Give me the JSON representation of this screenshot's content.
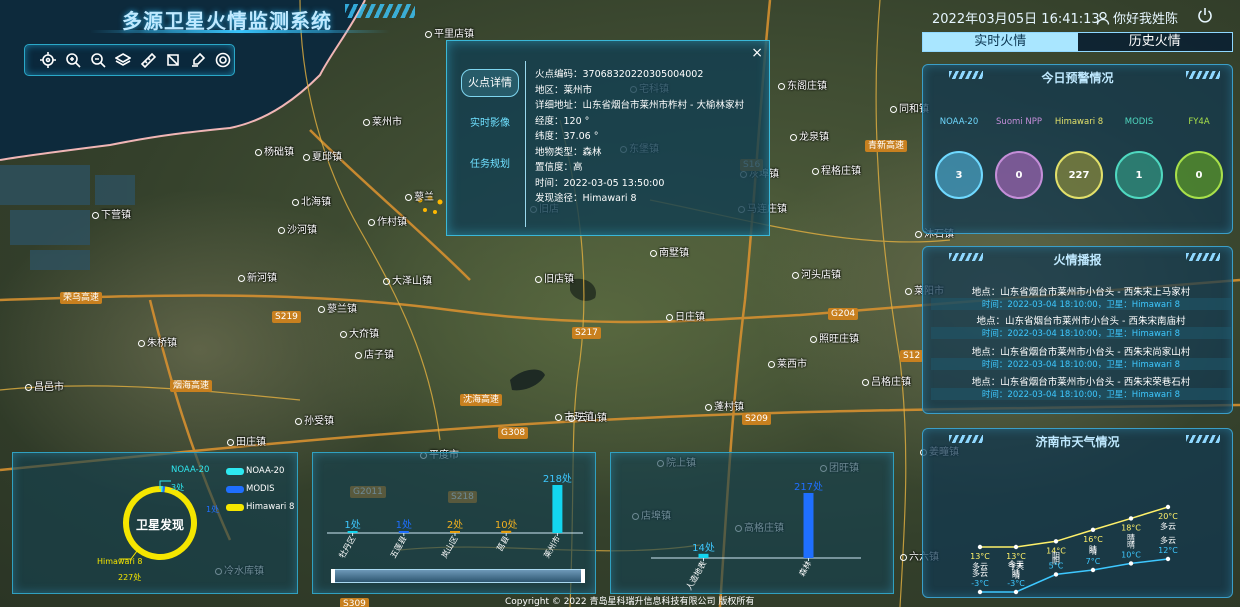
{
  "app": {
    "title": "多源卫星火情监测系统"
  },
  "toolbar": {
    "icons": [
      "locate-icon",
      "zoom-in-icon",
      "zoom-out-icon",
      "layers-icon",
      "measure-icon",
      "area-icon",
      "clear-icon",
      "settings-icon"
    ]
  },
  "header": {
    "datetime": "2022年03月05日 16:41:13",
    "user": "你好我姓陈"
  },
  "tabs": {
    "realtime": "实时火情",
    "history": "历史火情"
  },
  "map": {
    "places": [
      "平里店镇",
      "莱州市",
      "夏邱镇",
      "下营镇",
      "作村镇",
      "沙河镇",
      "新河镇",
      "大泽山镇",
      "日庄镇",
      "旧店镇",
      "南墅镇",
      "河头店镇",
      "莱阳市",
      "大夼镇",
      "马连庄镇",
      "照旺庄镇",
      "程格庄镇",
      "莱西市",
      "店子镇",
      "孙受镇",
      "朱桥镇",
      "蓬村镇",
      "古现镇",
      "吕格庄镇",
      "姜疃镇",
      "平度市",
      "田庄镇",
      "云山镇",
      "蓼兰镇",
      "团旺镇",
      "院上镇",
      "店埠镇",
      "昌邑市",
      "北海镇",
      "高格庄镇",
      "冷水库镇",
      "六六镇",
      "宅科镇",
      "东阁庄镇",
      "沐石镇",
      "杨础镇",
      "蓼兰",
      "龙泉镇",
      "灰埠镇",
      "旧店",
      "东堡镇",
      "同和镇"
    ],
    "roads": [
      "G18",
      "S219",
      "S217",
      "G204",
      "G308",
      "S209",
      "G2011",
      "S218",
      "S309",
      "S16",
      "S12",
      "荣乌高速",
      "沈海高速",
      "青新高速",
      "烟海高速"
    ]
  },
  "popup": {
    "tabs": [
      "火点详情",
      "实时影像",
      "任务规划"
    ],
    "close": "×",
    "lines": [
      "火点编码：37068320220305004002",
      "地区：莱州市",
      "详细地址：山东省烟台市莱州市柞村 - 大榆林家村",
      "经度：120 °",
      "纬度：37.06 °",
      "地物类型：森林",
      "置信度：高",
      "时间：2022-03-05 13:50:00",
      "发现途径：Himawari 8"
    ]
  },
  "alert": {
    "title": "今日预警情况",
    "sats": [
      {
        "name": "NOAA-20",
        "value": "3",
        "color": "#6fd9ff",
        "label_color": "#6fd9ff"
      },
      {
        "name": "Suomi NPP",
        "value": "0",
        "color": "#c48ed8",
        "label_color": "#c48ed8"
      },
      {
        "name": "Himawari 8",
        "value": "227",
        "color": "#e2e06a",
        "label_color": "#e2e06a"
      },
      {
        "name": "MODIS",
        "value": "1",
        "color": "#4fd8c0",
        "label_color": "#4fd8c0"
      },
      {
        "name": "FY4A",
        "value": "0",
        "color": "#a8e04a",
        "label_color": "#a8e04a"
      }
    ]
  },
  "broadcast": {
    "title": "火情播报",
    "items": [
      {
        "place": "地点：山东省烟台市莱州市小台头 - 西朱宋上马家村",
        "time": "时间：2022-03-04 18:10:00，卫星：Himawari 8"
      },
      {
        "place": "地点：山东省烟台市莱州市小台头 - 西朱宋南庙村",
        "time": "时间：2022-03-04 18:10:00，卫星：Himawari 8"
      },
      {
        "place": "地点：山东省烟台市莱州市小台头 - 西朱宋尚家山村",
        "time": "时间：2022-03-04 18:10:00，卫星：Himawari 8"
      },
      {
        "place": "地点：山东省烟台市莱州市小台头 - 西朱宋荣巷石村",
        "time": "时间：2022-03-04 18:10:00，卫星：Himawari 8"
      }
    ]
  },
  "weather": {
    "title": "济南市天气情况",
    "high": {
      "conds": [
        "多云",
        "今天\n晴",
        "阴",
        "晴",
        "晴",
        "多云"
      ],
      "temps": [
        13,
        13,
        14,
        16,
        18,
        20
      ],
      "labels": [
        "13°C",
        "13°C",
        "14°C",
        "16°C",
        "18°C",
        "20°C"
      ]
    },
    "low": {
      "conds": [
        "多云",
        "今天\n晴",
        "阴",
        "晴",
        "晴",
        "多云"
      ],
      "temps": [
        -3,
        -3,
        5,
        7,
        10,
        12
      ],
      "labels": [
        "-3°C",
        "-3°C",
        "5°C",
        "7°C",
        "10°C",
        "12°C"
      ]
    },
    "high_color": "#fff16a",
    "low_color": "#3ec8ff"
  },
  "discover": {
    "title": "卫星发现",
    "legend": [
      "NOAA-20",
      "MODIS",
      "Himawari 8"
    ],
    "legend_colors": [
      "#2ee8f0",
      "#1f6fff",
      "#f5e600"
    ],
    "labels": {
      "top": "NOAA-20",
      "top_val": "3处",
      "bottom": "Himawari 8",
      "bottom_val": "227处",
      "mid": "1处"
    },
    "values": [
      3,
      1,
      227
    ]
  },
  "chart_data": [
    {
      "type": "bar",
      "categories": [
        "牡丹区",
        "五莲县",
        "岚山区",
        "莒县",
        "莱州市"
      ],
      "values": [
        1,
        1,
        2,
        10,
        218
      ],
      "labels": [
        "1处",
        "1处",
        "2处",
        "10处",
        "218处"
      ]
    },
    {
      "type": "bar",
      "categories": [
        "人造地表",
        "森林"
      ],
      "values": [
        14,
        217
      ],
      "labels": [
        "14处",
        "217处"
      ]
    }
  ],
  "footer": {
    "copyright": "Copyright © 2022 青岛星科瑞升信息科技有限公司 版权所有"
  }
}
